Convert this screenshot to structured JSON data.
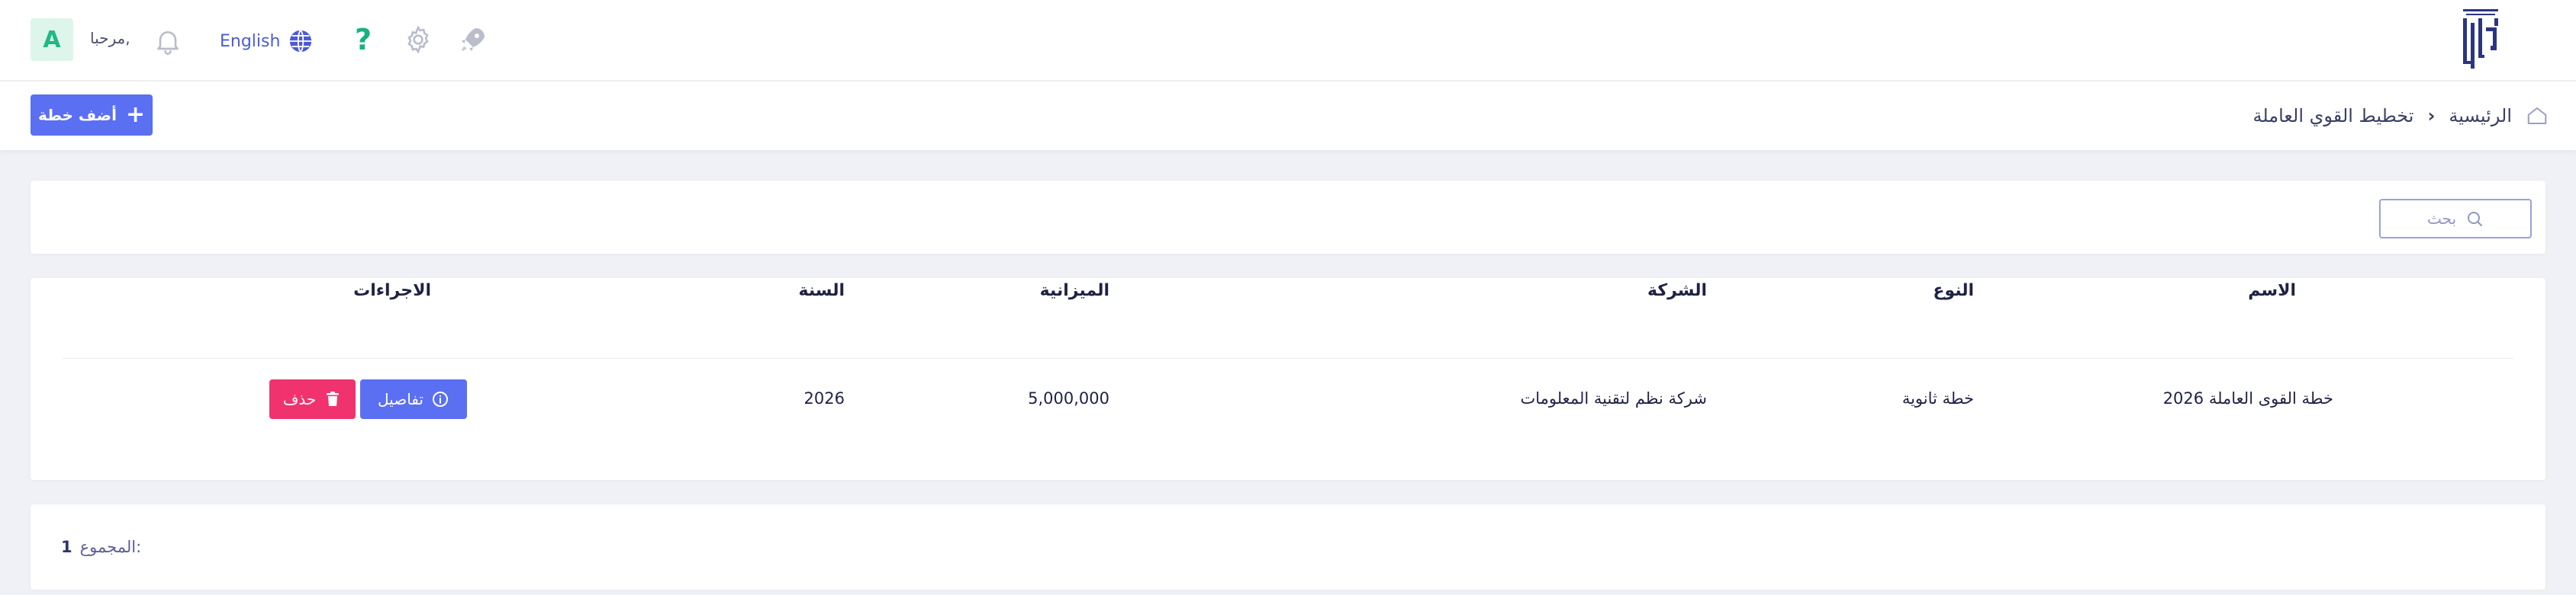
{
  "header": {
    "avatar_initial": "A",
    "greeting": "مرحبا,",
    "language_label": "English",
    "help_glyph": "?",
    "icons": [
      "bell-icon",
      "globe-icon",
      "question-icon",
      "gear-icon",
      "rocket-icon",
      "logo"
    ],
    "colors": {
      "accent": "#5b6ff2",
      "help": "#17b27f",
      "danger": "#f0336f",
      "avatar_bg": "#ddf5ea"
    }
  },
  "breadcrumb": {
    "home": "الرئيسية",
    "current": "تخطيط القوي العاملة"
  },
  "toolbar": {
    "add_plan_label": "أضف خطة"
  },
  "search": {
    "placeholder": "بحث"
  },
  "table": {
    "columns": {
      "name": "الاسم",
      "type": "النوع",
      "company": "الشركة",
      "budget": "الميزانية",
      "year": "السنة",
      "actions": "الاجراءات"
    },
    "rows": [
      {
        "name": "خطة القوى العاملة 2026",
        "type": "خطة ثانوية",
        "company": "شركة نظم لتقنية المعلومات",
        "budget": "5,000,000",
        "year": "2026",
        "details_label": "تفاصيل",
        "delete_label": "حذف"
      }
    ]
  },
  "footer": {
    "total_label": "المجموع:",
    "total_value": "1"
  }
}
